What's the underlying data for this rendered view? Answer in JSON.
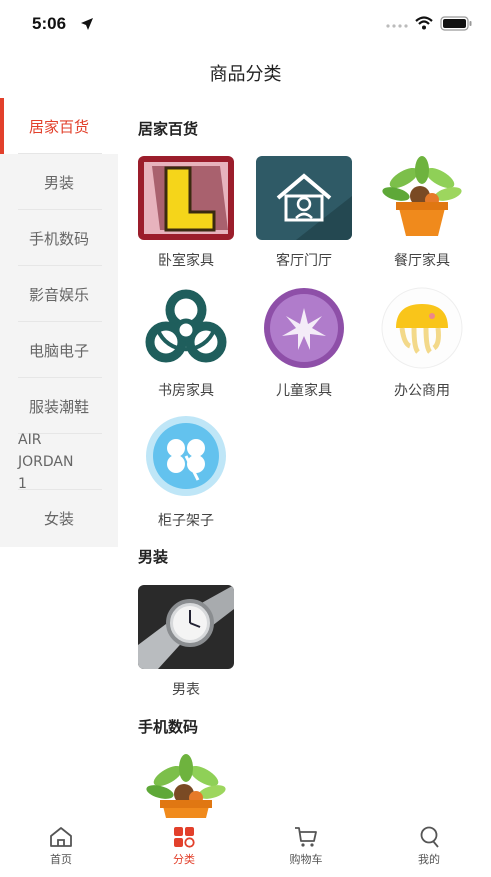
{
  "status_bar": {
    "time": "5:06"
  },
  "header": {
    "title": "商品分类"
  },
  "colors": {
    "accent": "#e2402b",
    "sidebar_bg": "#f4f4f4"
  },
  "sidebar": {
    "items": [
      {
        "label": "居家百货",
        "active": true
      },
      {
        "label": "男装"
      },
      {
        "label": "手机数码"
      },
      {
        "label": "影音娱乐"
      },
      {
        "label": "电脑电子"
      },
      {
        "label": "服装潮鞋"
      },
      {
        "label": "AIR\nJORDAN\n1"
      },
      {
        "label": "女装"
      }
    ]
  },
  "sections": [
    {
      "title": "居家百货",
      "items": [
        {
          "label": "卧室家具",
          "icon": "letter-l-icon"
        },
        {
          "label": "客厅门厅",
          "icon": "house-icon"
        },
        {
          "label": "餐厅家具",
          "icon": "potted-plant-icon"
        },
        {
          "label": "书房家具",
          "icon": "biohazard-icon"
        },
        {
          "label": "儿童家具",
          "icon": "starburst-icon"
        },
        {
          "label": "办公商用",
          "icon": "jellyfish-icon"
        },
        {
          "label": "柜子架子",
          "icon": "clover-icon"
        }
      ]
    },
    {
      "title": "男装",
      "items": [
        {
          "label": "男表",
          "icon": "watch-icon"
        }
      ]
    },
    {
      "title": "手机数码",
      "items": [
        {
          "icon": "potted-plant-icon"
        }
      ]
    }
  ],
  "tabbar": {
    "items": [
      {
        "label": "首页",
        "icon": "home-icon"
      },
      {
        "label": "分类",
        "icon": "category-icon",
        "active": true
      },
      {
        "label": "购物车",
        "icon": "cart-icon"
      },
      {
        "label": "我的",
        "icon": "profile-icon"
      }
    ]
  }
}
